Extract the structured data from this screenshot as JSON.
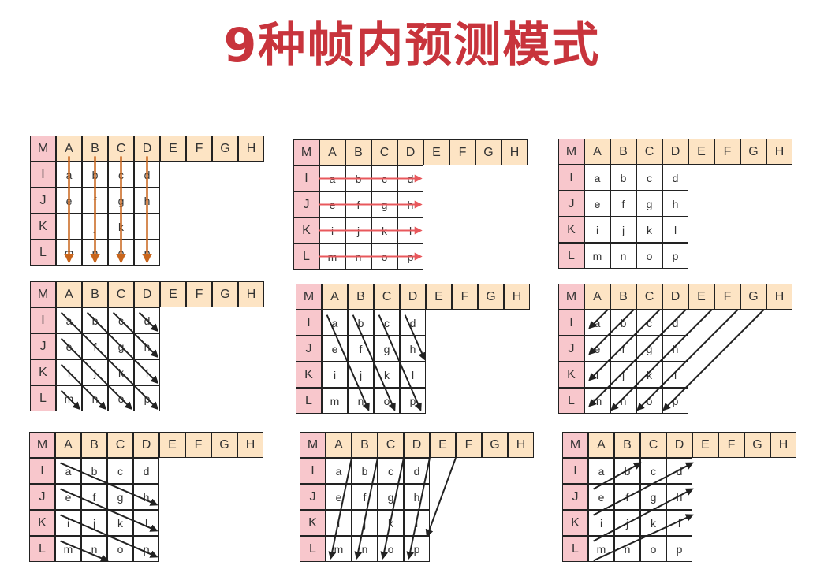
{
  "title": "9种帧内预测模式",
  "colors": {
    "title": "#c8343c",
    "top_fill": "#fde4c4",
    "left_fill": "#f8c7cc",
    "arrow_vertical": "#c8651c",
    "arrow_horizontal": "#e8585c",
    "arrow_diagonal": "#222222"
  },
  "grid": {
    "corner": "M",
    "top": [
      "A",
      "B",
      "C",
      "D",
      "E",
      "F",
      "G",
      "H"
    ],
    "left": [
      "I",
      "J",
      "K",
      "L"
    ],
    "inner": [
      [
        "a",
        "b",
        "c",
        "d"
      ],
      [
        "e",
        "f",
        "g",
        "h"
      ],
      [
        "i",
        "j",
        "k",
        "l"
      ],
      [
        "m",
        "n",
        "o",
        "p"
      ]
    ]
  },
  "modes": [
    {
      "id": "mode-vertical",
      "arrow": "vertical"
    },
    {
      "id": "mode-horizontal",
      "arrow": "horizontal"
    },
    {
      "id": "mode-dc",
      "arrow": "none"
    },
    {
      "id": "mode-diagonal-down-right",
      "arrow": "diag-down-right"
    },
    {
      "id": "mode-vertical-right",
      "arrow": "vertical-right"
    },
    {
      "id": "mode-diagonal-down-left",
      "arrow": "diag-down-left"
    },
    {
      "id": "mode-horizontal-down",
      "arrow": "horizontal-down"
    },
    {
      "id": "mode-vertical-left",
      "arrow": "vertical-left"
    },
    {
      "id": "mode-horizontal-up",
      "arrow": "horizontal-up"
    }
  ]
}
